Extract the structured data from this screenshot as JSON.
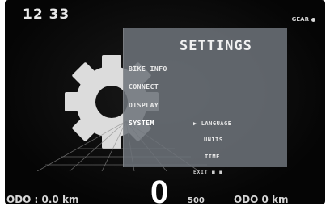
{
  "status_bar": {
    "time": "12 33",
    "connection_label": "GEAR",
    "connection_icon": "bluetooth-dot-icon"
  },
  "settings_panel": {
    "title": "SETTINGS",
    "menu_items": [
      {
        "label": "BIKE INFO",
        "active": false
      },
      {
        "label": "CONNECT",
        "active": false
      },
      {
        "label": "DISPLAY",
        "active": false
      },
      {
        "label": "SYSTEM",
        "active": true
      }
    ],
    "submenu_items": [
      {
        "label": "LANGUAGE",
        "selected": true
      },
      {
        "label": "UNITS",
        "selected": false
      },
      {
        "label": "TIME",
        "selected": false
      }
    ],
    "selection_marker": "▶"
  },
  "dashboard": {
    "nav_hint": "EXIT ■ ■",
    "speed": "0",
    "bottom_left": "ODO : 0.0 km",
    "bottom_mid": "500",
    "bottom_right": "ODO 0 km"
  },
  "colors": {
    "panel_background": "#6e737a",
    "display_background": "#050505",
    "text_primary": "#f1f1f1",
    "gear_color": "#dcdcdc"
  }
}
